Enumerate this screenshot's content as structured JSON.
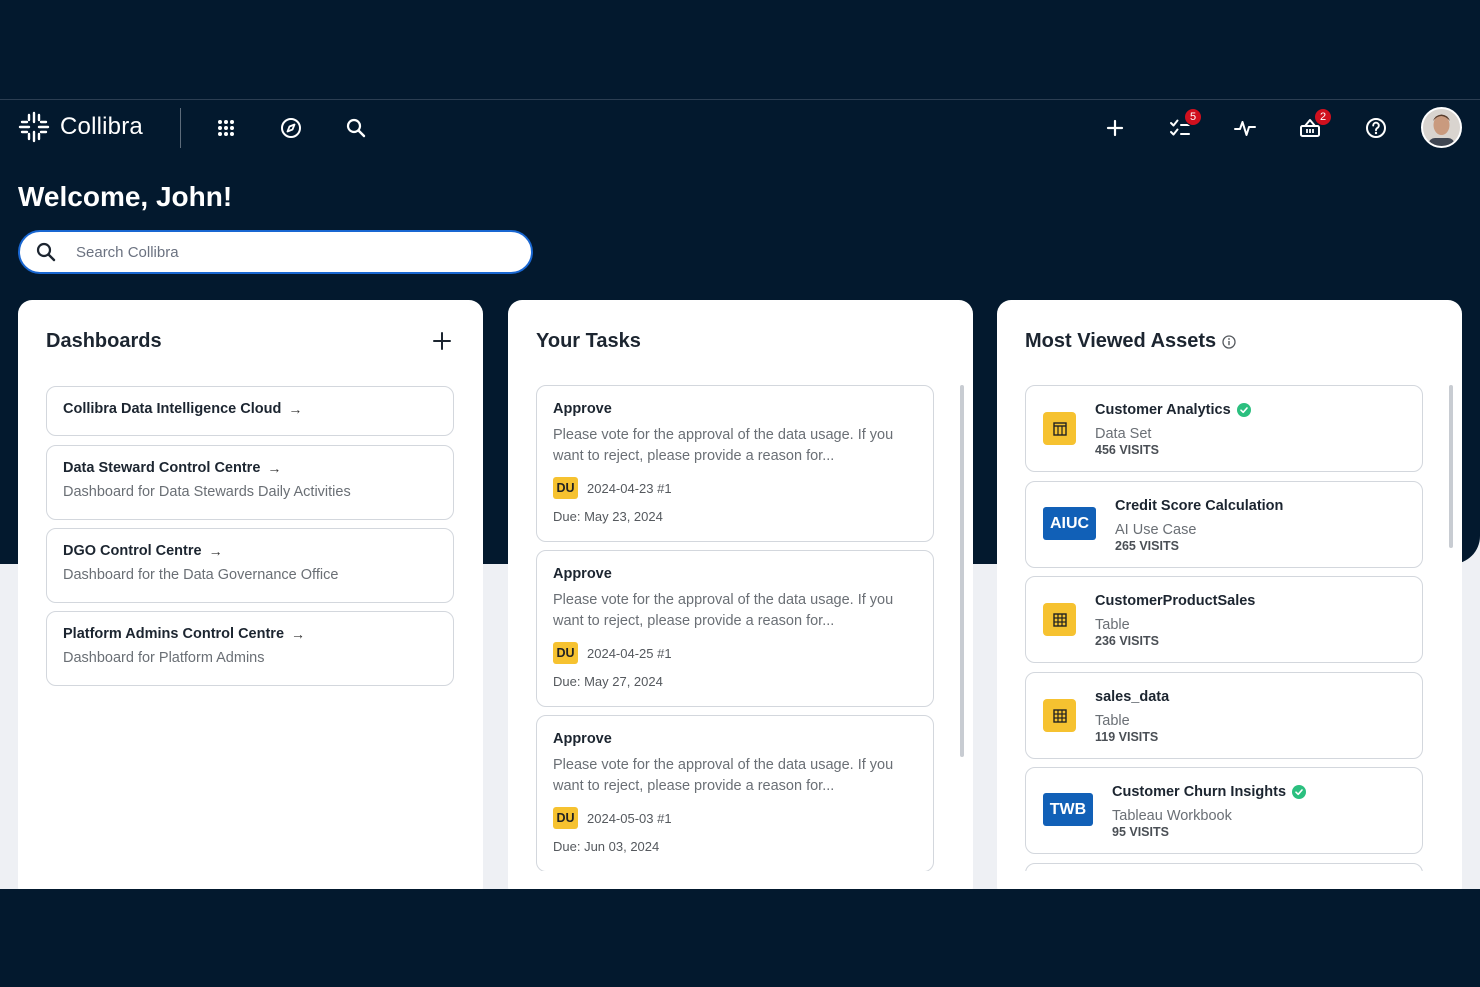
{
  "app": {
    "name": "Collibra"
  },
  "header": {
    "tasks_badge": "5",
    "basket_badge": "2"
  },
  "welcome": "Welcome, John!",
  "search": {
    "placeholder": "Search Collibra"
  },
  "dashboards": {
    "title": "Dashboards",
    "items": [
      {
        "title": "Collibra Data Intelligence Cloud",
        "subtitle": ""
      },
      {
        "title": "Data Steward Control Centre",
        "subtitle": "Dashboard for Data Stewards Daily Activities"
      },
      {
        "title": "DGO Control Centre",
        "subtitle": "Dashboard for the Data Governance Office"
      },
      {
        "title": "Platform Admins Control Centre",
        "subtitle": "Dashboard for Platform Admins"
      }
    ]
  },
  "tasks": {
    "title": "Your Tasks",
    "items": [
      {
        "title": "Approve",
        "description": "Please vote for the approval of the data usage. If you want to reject, please provide a reason for...",
        "assignee": "DU",
        "meta": "2024-04-23 #1",
        "due": "Due: May 23, 2024"
      },
      {
        "title": "Approve",
        "description": "Please vote for the approval of the data usage. If you want to reject, please provide a reason for...",
        "assignee": "DU",
        "meta": "2024-04-25 #1",
        "due": "Due: May 27, 2024"
      },
      {
        "title": "Approve",
        "description": "Please vote for the approval of the data usage. If you want to reject, please provide a reason for...",
        "assignee": "DU",
        "meta": "2024-05-03 #1",
        "due": "Due: Jun 03, 2024"
      }
    ]
  },
  "assets": {
    "title": "Most Viewed Assets",
    "items": [
      {
        "name": "Customer Analytics",
        "type": "Data Set",
        "visits": "456 VISITS",
        "icon": "dataset-icon",
        "verified": true
      },
      {
        "name": "Credit Score Calculation",
        "type": "AI Use Case",
        "visits": "265 VISITS",
        "tag": "AIUC",
        "verified": false
      },
      {
        "name": "CustomerProductSales",
        "type": "Table",
        "visits": "236 VISITS",
        "icon": "table-icon",
        "verified": false
      },
      {
        "name": "sales_data",
        "type": "Table",
        "visits": "119 VISITS",
        "icon": "table-icon",
        "verified": false
      },
      {
        "name": "Customer Churn Insights",
        "type": "Tableau Workbook",
        "visits": "95 VISITS",
        "tag": "TWB",
        "verified": true
      }
    ]
  },
  "colors": {
    "navy": "#03192e",
    "accent_blue": "#1967d2",
    "badge_red": "#d0101e",
    "tag_yellow": "#f6c230",
    "tag_blue": "#1160b7",
    "verified_green": "#2bbf7f"
  }
}
